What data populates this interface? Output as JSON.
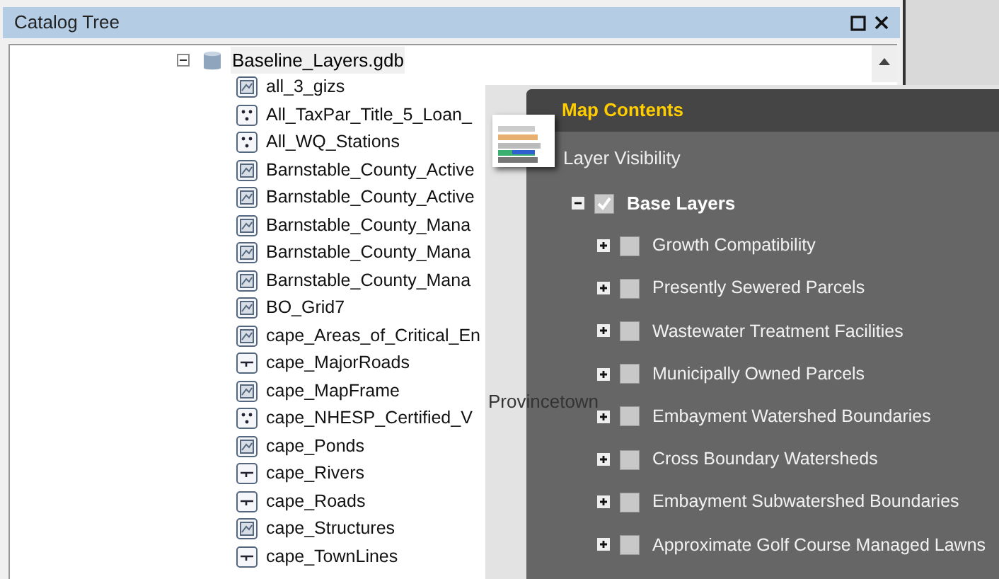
{
  "catalog": {
    "title": "Catalog Tree",
    "root": {
      "label": "Baseline_Layers.gdb",
      "expanded": true,
      "selected": true,
      "children": [
        {
          "label": "all_3_gizs",
          "kind": "polygon"
        },
        {
          "label": "All_TaxPar_Title_5_Loan_",
          "kind": "point"
        },
        {
          "label": "All_WQ_Stations",
          "kind": "point"
        },
        {
          "label": "Barnstable_County_Active",
          "kind": "polygon"
        },
        {
          "label": "Barnstable_County_Active",
          "kind": "polygon"
        },
        {
          "label": "Barnstable_County_Mana",
          "kind": "polygon"
        },
        {
          "label": "Barnstable_County_Mana",
          "kind": "polygon"
        },
        {
          "label": "Barnstable_County_Mana",
          "kind": "polygon"
        },
        {
          "label": "BO_Grid7",
          "kind": "polygon"
        },
        {
          "label": "cape_Areas_of_Critical_En",
          "kind": "polygon"
        },
        {
          "label": "cape_MajorRoads",
          "kind": "line"
        },
        {
          "label": "cape_MapFrame",
          "kind": "polygon"
        },
        {
          "label": "cape_NHESP_Certified_V",
          "kind": "point"
        },
        {
          "label": "cape_Ponds",
          "kind": "polygon"
        },
        {
          "label": "cape_Rivers",
          "kind": "line"
        },
        {
          "label": "cape_Roads",
          "kind": "line"
        },
        {
          "label": "cape_Structures",
          "kind": "polygon"
        },
        {
          "label": "cape_TownLines",
          "kind": "line"
        }
      ]
    }
  },
  "map": {
    "labels": [
      "Provincetown"
    ]
  },
  "map_contents": {
    "title": "Map Contents",
    "subtitle": "Layer Visibility",
    "group": {
      "label": "Base Layers",
      "expanded": true,
      "checked": true,
      "children": [
        {
          "label": "Growth Compatibility",
          "expanded": false,
          "checked": false
        },
        {
          "label": "Presently Sewered Parcels",
          "expanded": false,
          "checked": false
        },
        {
          "label": "Wastewater Treatment Facilities",
          "expanded": false,
          "checked": false
        },
        {
          "label": "Municipally Owned Parcels",
          "expanded": false,
          "checked": false
        },
        {
          "label": "Embayment Watershed Boundaries",
          "expanded": false,
          "checked": false
        },
        {
          "label": "Cross Boundary Watersheds",
          "expanded": false,
          "checked": false
        },
        {
          "label": "Embayment Subwatershed Boundaries",
          "expanded": false,
          "checked": false
        },
        {
          "label": "Approximate Golf Course Managed Lawns",
          "expanded": false,
          "checked": false
        }
      ]
    }
  }
}
